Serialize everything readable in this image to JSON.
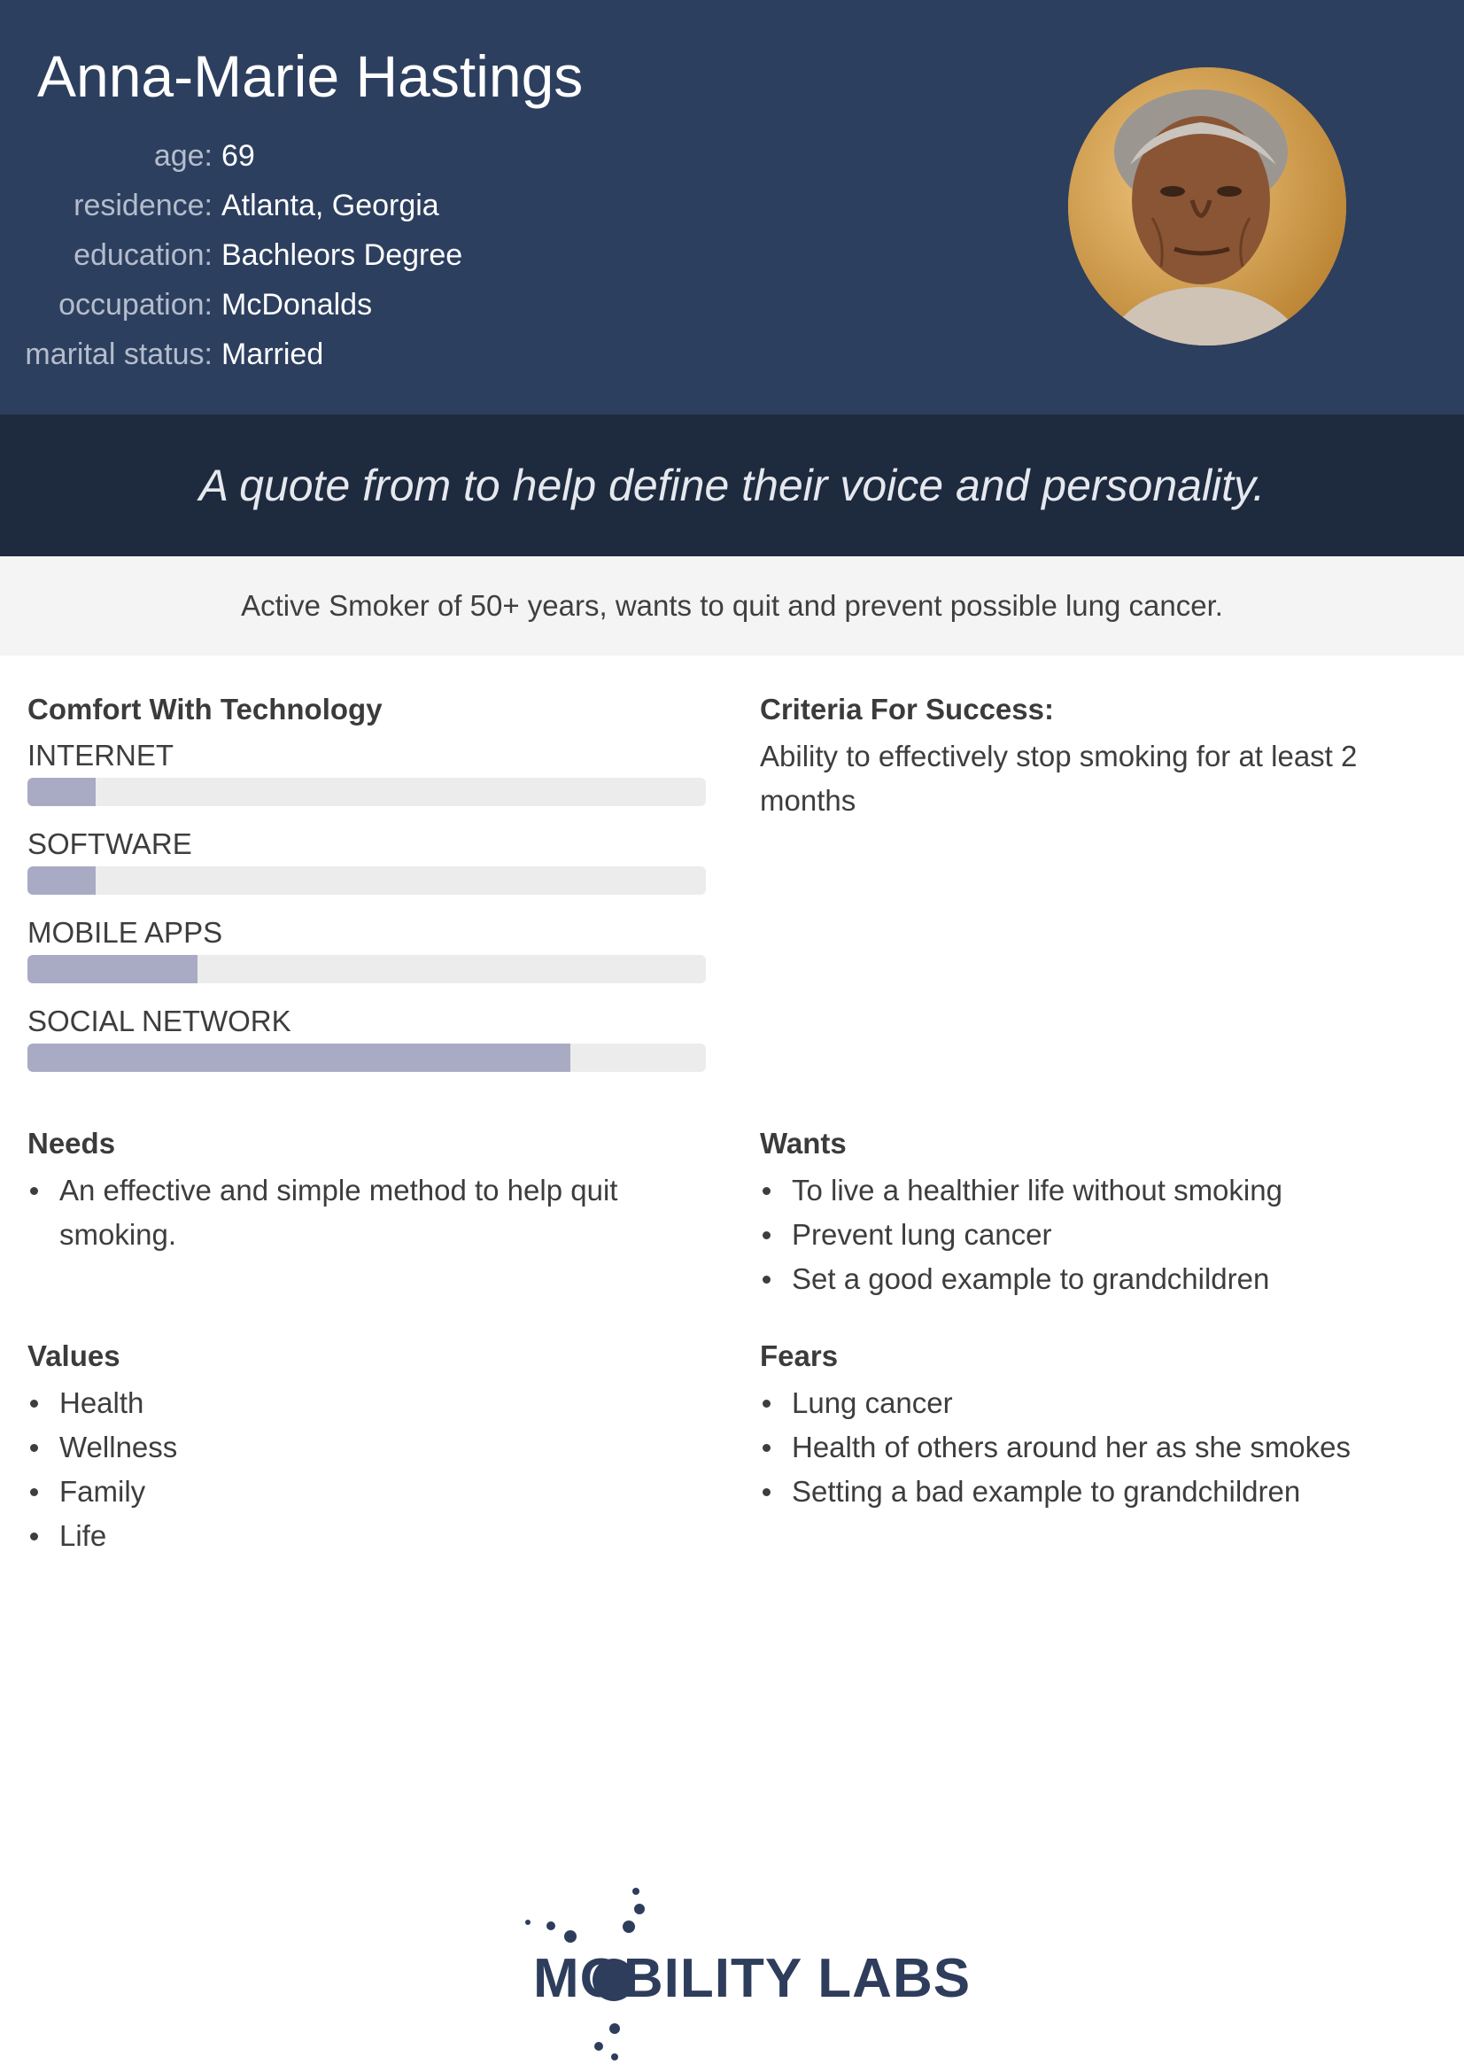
{
  "persona": {
    "name": "Anna-Marie Hastings",
    "details": [
      {
        "label": "age:",
        "value": "69"
      },
      {
        "label": "residence:",
        "value": "Atlanta, Georgia"
      },
      {
        "label": "education:",
        "value": "Bachleors Degree"
      },
      {
        "label": "occupation:",
        "value": "McDonalds"
      },
      {
        "label": "marital status:",
        "value": "Married"
      }
    ]
  },
  "quote": "A quote from to help define their voice and personality.",
  "summary": "Active Smoker of 50+ years, wants to quit and prevent possible lung cancer.",
  "comfort": {
    "title": "Comfort With Technology",
    "skills": [
      {
        "label": "INTERNET",
        "level": 0.1
      },
      {
        "label": "SOFTWARE",
        "level": 0.1
      },
      {
        "label": "MOBILE APPS",
        "level": 0.25
      },
      {
        "label": "SOCIAL NETWORK",
        "level": 0.8
      }
    ]
  },
  "criteria": {
    "title": "Criteria For Success:",
    "text": "Ability to effectively stop smoking for at least 2 months"
  },
  "needs": {
    "title": "Needs",
    "items": [
      "An effective and simple method to help quit smoking."
    ]
  },
  "wants": {
    "title": "Wants",
    "items": [
      "To live a healthier life without smoking",
      "Prevent lung cancer",
      "Set a good example to grandchildren"
    ]
  },
  "values": {
    "title": "Values",
    "items": [
      "Health",
      "Wellness",
      "Family",
      "Life"
    ]
  },
  "fears": {
    "title": "Fears",
    "items": [
      "Lung cancer",
      "Health of others around her as she smokes",
      "Setting a bad example to grandchildren"
    ]
  },
  "logo": {
    "text": "MOBILITY LABS"
  },
  "colors": {
    "header": "#2d3f5f",
    "quote_band": "#1e2a3e",
    "bar_fill": "#a9abc4",
    "bar_track": "#ececec"
  }
}
